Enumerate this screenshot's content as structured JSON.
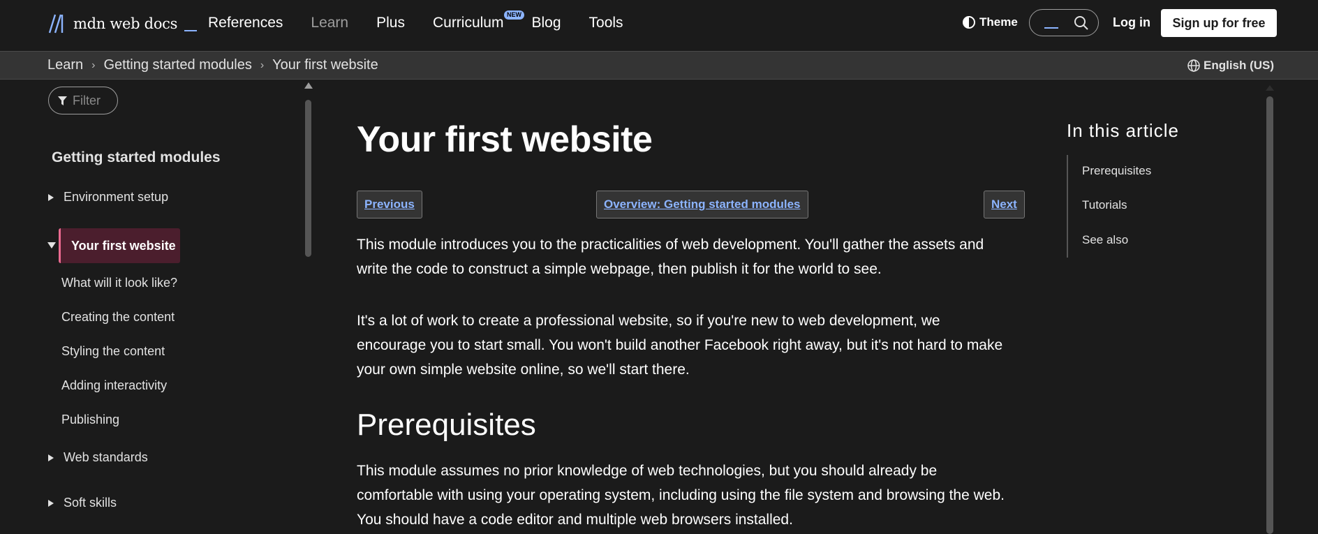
{
  "header": {
    "logo_text": "mdn web docs",
    "nav": [
      "References",
      "Learn",
      "Plus",
      "Curriculum",
      "Blog",
      "Tools"
    ],
    "new_badge": "NEW",
    "theme_label": "Theme",
    "login_label": "Log in",
    "signup_label": "Sign up for free"
  },
  "breadcrumb": {
    "items": [
      "Learn",
      "Getting started modules",
      "Your first website"
    ],
    "language": "English (US)"
  },
  "sidebar": {
    "filter_placeholder": "Filter",
    "heading": "Getting started modules",
    "sections": [
      {
        "label": "Environment setup",
        "expanded": false
      },
      {
        "label": "Your first website",
        "expanded": true,
        "active": true
      },
      {
        "label": "Web standards",
        "expanded": false
      },
      {
        "label": "Soft skills",
        "expanded": false
      }
    ],
    "sub_items": [
      "What will it look like?",
      "Creating the content",
      "Styling the content",
      "Adding interactivity",
      "Publishing"
    ]
  },
  "main": {
    "title": "Your first website",
    "pager": {
      "previous": "Previous",
      "overview": "Overview: Getting started modules",
      "next": "Next"
    },
    "paragraphs": [
      [
        "This module introduces you to the practicalities of web development. You'll gather the assets and",
        "write the code to construct a simple webpage, then publish it for the world to see."
      ],
      [
        "It's a lot of work to create a professional website, so if you're new to web development, we",
        "encourage you to start small. You won't build another Facebook right away, but it's not hard to make",
        "your own simple website online, so we'll start there."
      ]
    ],
    "h2": "Prerequisites",
    "prereq_paragraph": [
      "This module assumes no prior knowledge of web technologies, but you should already be",
      "comfortable with using your operating system, including using the file system and browsing the web.",
      "You should have a code editor and multiple web browsers installed."
    ]
  },
  "toc": {
    "title": "In this article",
    "links": [
      "Prerequisites",
      "Tutorials",
      "See also"
    ]
  },
  "colors": {
    "background": "#1b1b1b",
    "accent_link": "#8cb4ff",
    "active_item_bg": "#4b1e2d",
    "active_item_border": "#ea6a90"
  }
}
